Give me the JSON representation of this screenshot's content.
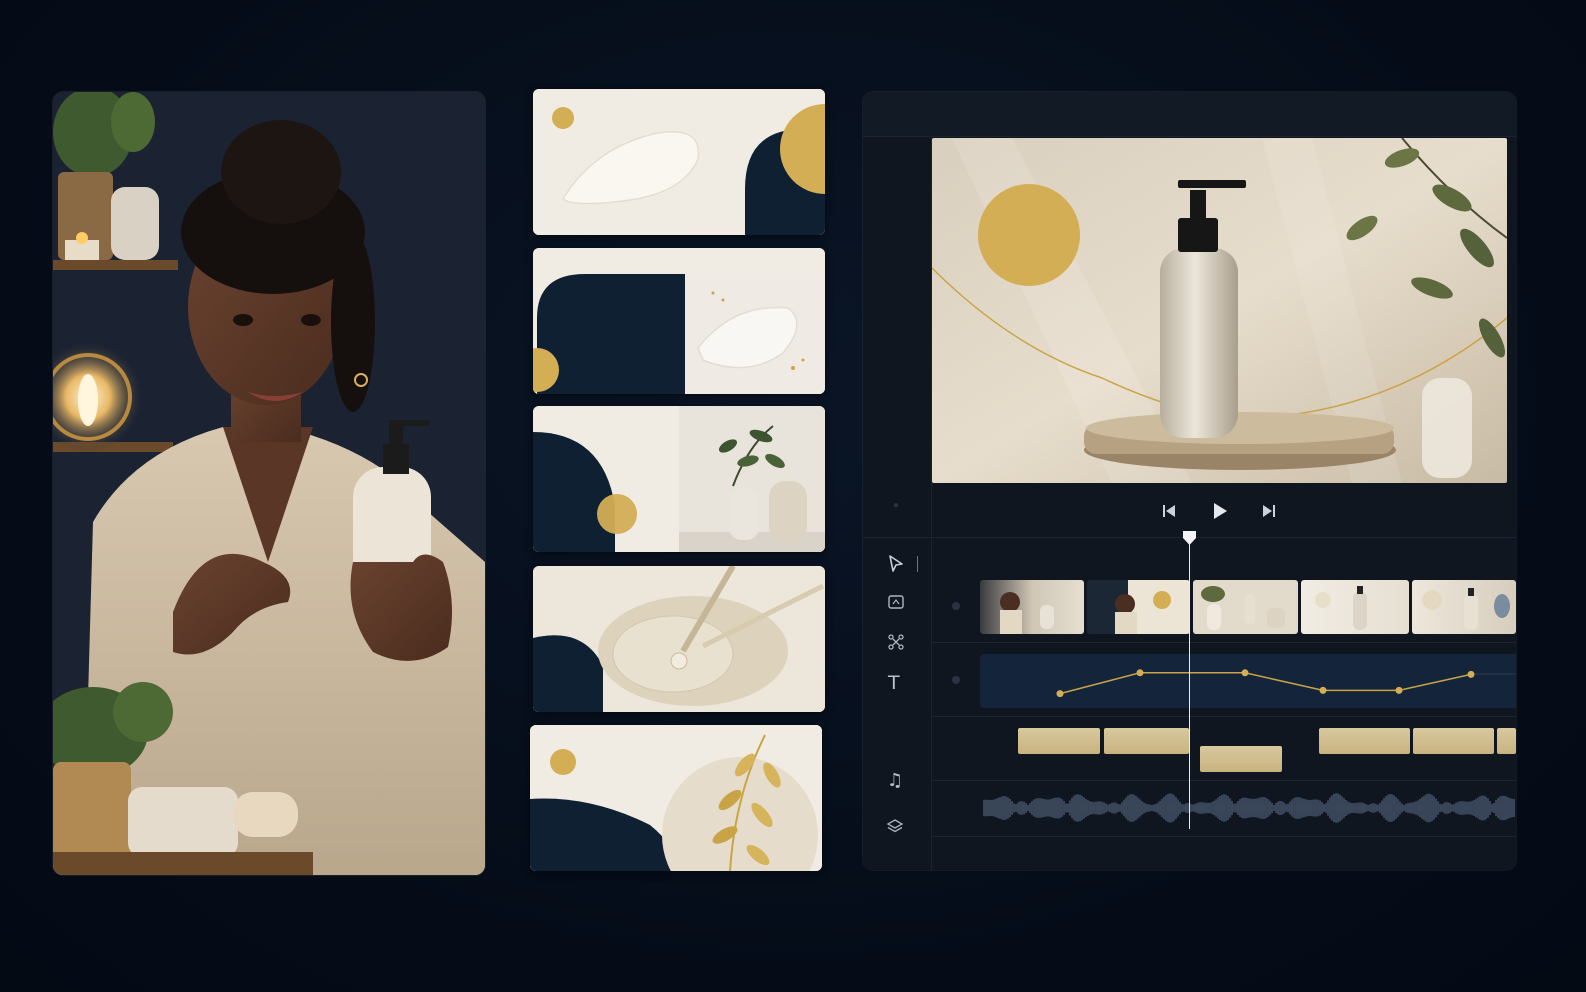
{
  "colors": {
    "background": "#050c18",
    "navy": "#0f2033",
    "cream": "#f1ece3",
    "gold": "#d3ae55",
    "accent_gold": "#c9a447",
    "panel": "#0f1620"
  },
  "editor": {
    "transport": {
      "prev_icon": "skip-back-icon",
      "play_icon": "play-icon",
      "next_icon": "skip-forward-icon"
    },
    "tools": [
      {
        "icon": "cursor-icon"
      },
      {
        "icon": "crop-icon"
      },
      {
        "icon": "magic-select-icon"
      },
      {
        "icon": "text-icon",
        "glyph": "T"
      },
      {
        "icon": "music-note-icon",
        "glyph": "♫"
      },
      {
        "icon": "layers-icon"
      }
    ],
    "keyframe_values": [
      0.2,
      0.85,
      0.85,
      0.3,
      0.3,
      0.8
    ]
  },
  "templates": [
    {
      "name": "cream-swatch-template"
    },
    {
      "name": "gel-swatch-template"
    },
    {
      "name": "vase-template"
    },
    {
      "name": "serum-dropper-template"
    },
    {
      "name": "golden-leaf-template"
    }
  ]
}
